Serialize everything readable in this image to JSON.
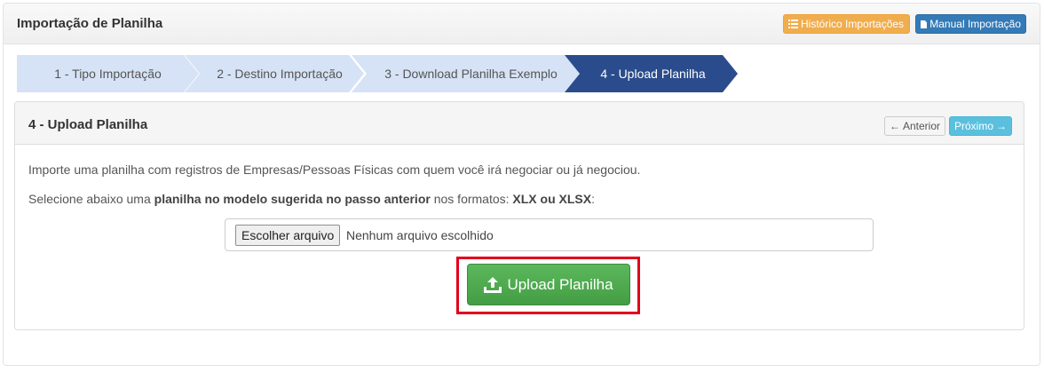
{
  "header": {
    "title": "Importação de Planilha",
    "history_label": "Histórico Importações",
    "manual_label": "Manual Importação"
  },
  "steps": [
    {
      "label": "1 - Tipo Importação",
      "active": false
    },
    {
      "label": "2 - Destino Importação",
      "active": false
    },
    {
      "label": "3 - Download Planilha Exemplo",
      "active": false
    },
    {
      "label": "4 - Upload Planilha",
      "active": true
    }
  ],
  "panel": {
    "title": "4 - Upload Planilha",
    "prev_label": "Anterior",
    "next_label": "Próximo",
    "intro_text": "Importe uma planilha com registros de Empresas/Pessoas Físicas com quem você irá negociar ou já negociou.",
    "select_text_a": "Selecione abaixo uma ",
    "select_text_b": "planilha no modelo sugerida no passo anterior",
    "select_text_c": " nos formatos: ",
    "select_text_d": "XLX ou XLSX",
    "select_text_e": ":",
    "file_button_label": "Escolher arquivo",
    "file_status": "Nenhum arquivo escolhido",
    "upload_label": "Upload Planilha"
  },
  "colors": {
    "step_inactive": "#d6e2f5",
    "step_active": "#2a4c8c",
    "upload_green": "#5cb85c",
    "highlight_red": "#e2001a",
    "history_orange": "#f0ad4e",
    "manual_blue": "#337ab7",
    "next_cyan": "#5bc0de"
  },
  "icons": {
    "history": "list-icon",
    "manual": "file-icon",
    "prev": "arrow-left-icon",
    "next": "arrow-right-icon",
    "upload": "upload-icon"
  }
}
